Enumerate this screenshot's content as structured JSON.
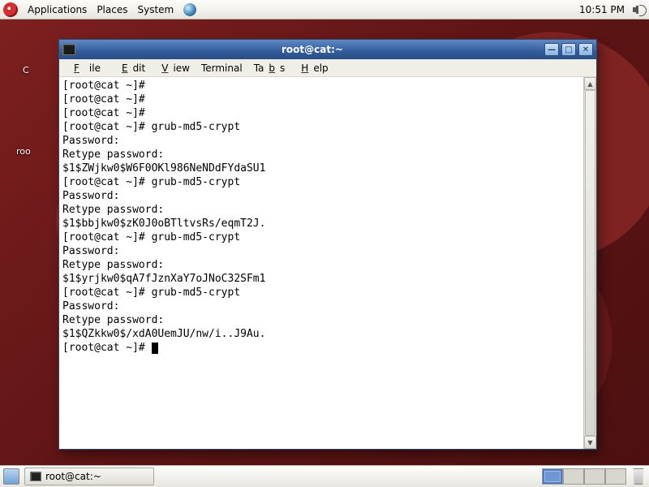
{
  "panel": {
    "applications": "Applications",
    "places": "Places",
    "system": "System",
    "clock": "10:51 PM"
  },
  "desktop": {
    "label_computer": "C",
    "label_root_home": "roo"
  },
  "window": {
    "title": "root@cat:~",
    "menus": {
      "file": "File",
      "edit": "Edit",
      "view": "View",
      "terminal": "Terminal",
      "tabs": "Tabs",
      "help": "Help"
    },
    "terminal_lines": [
      "[root@cat ~]#",
      "[root@cat ~]#",
      "[root@cat ~]#",
      "[root@cat ~]# grub-md5-crypt",
      "Password:",
      "Retype password:",
      "$1$ZWjkw0$W6F0OKl986NeNDdFYdaSU1",
      "[root@cat ~]# grub-md5-crypt",
      "Password:",
      "Retype password:",
      "$1$bbjkw0$zK0J0oBTltvsRs/eqmT2J.",
      "[root@cat ~]# grub-md5-crypt",
      "Password:",
      "Retype password:",
      "$1$yrjkw0$qA7fJznXaY7oJNoC32SFm1",
      "[root@cat ~]# grub-md5-crypt",
      "Password:",
      "Retype password:",
      "$1$QZkkw0$/xdA0UemJU/nw/i..J9Au.",
      "[root@cat ~]# "
    ]
  },
  "taskbar": {
    "task_label": "root@cat:~"
  }
}
